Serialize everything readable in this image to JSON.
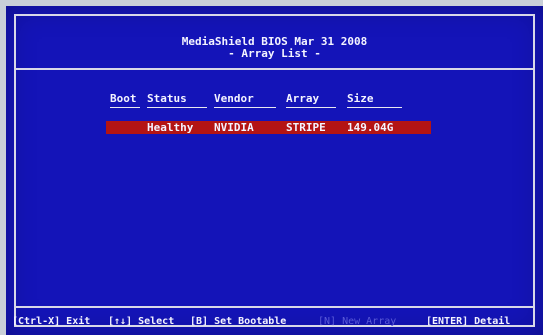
{
  "header": {
    "line1": "MediaShield BIOS   Mar 31 2008",
    "line2": "- Array List -"
  },
  "table": {
    "columns": [
      "Boot",
      "Status",
      "Vendor",
      "Array",
      "Size"
    ],
    "rows": [
      {
        "boot": "",
        "status": "Healthy",
        "vendor": "NVIDIA",
        "array": "STRIPE",
        "size": "149.04G",
        "selected": true
      }
    ]
  },
  "footer": {
    "exit": "[Ctrl-X] Exit",
    "select": "[↑↓] Select",
    "set_bootable": "[B] Set Bootable",
    "new_array": "[N] New Array",
    "detail": "[ENTER] Detail"
  },
  "colors": {
    "background": "#1414b8",
    "foreground": "#f4f4ff",
    "highlight": "#b41414",
    "disabled": "#5a5ad8"
  }
}
